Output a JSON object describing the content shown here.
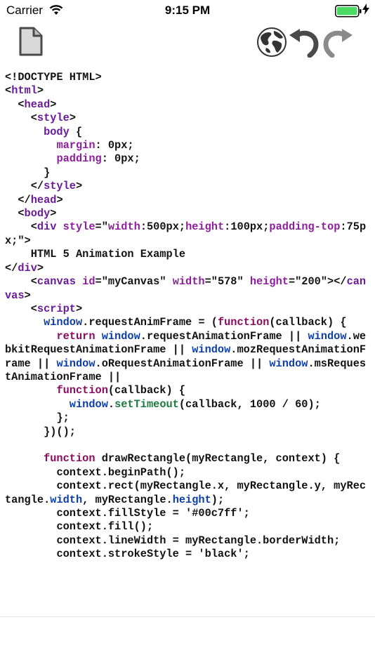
{
  "status_bar": {
    "carrier": "Carrier",
    "time": "9:15 PM"
  },
  "toolbar": {
    "icons": [
      "file-icon",
      "globe-icon",
      "undo-icon",
      "redo-icon"
    ]
  },
  "colors": {
    "default": "#111111",
    "tag": "#6a1b9a",
    "attr": "#8e1e9e",
    "keyword": "#8b0c5f",
    "ident": "#0d3ea8",
    "func": "#1b7a3d",
    "battery": "#4cd964"
  },
  "code": {
    "lines": [
      [
        [
          "default",
          "<!DOCTYPE HTML>"
        ]
      ],
      [
        [
          "default",
          "<"
        ],
        [
          "tag",
          "html"
        ],
        [
          "default",
          ">"
        ]
      ],
      [
        [
          "default",
          "  <"
        ],
        [
          "tag",
          "head"
        ],
        [
          "default",
          ">"
        ]
      ],
      [
        [
          "default",
          "    <"
        ],
        [
          "tag",
          "style"
        ],
        [
          "default",
          ">"
        ]
      ],
      [
        [
          "default",
          "      "
        ],
        [
          "tag",
          "body"
        ],
        [
          "default",
          " {"
        ]
      ],
      [
        [
          "default",
          "        "
        ],
        [
          "attr",
          "margin"
        ],
        [
          "default",
          ": 0px;"
        ]
      ],
      [
        [
          "default",
          "        "
        ],
        [
          "attr",
          "padding"
        ],
        [
          "default",
          ": 0px;"
        ]
      ],
      [
        [
          "default",
          "      }"
        ]
      ],
      [
        [
          "default",
          "    </"
        ],
        [
          "tag",
          "style"
        ],
        [
          "default",
          ">"
        ]
      ],
      [
        [
          "default",
          "  </"
        ],
        [
          "tag",
          "head"
        ],
        [
          "default",
          ">"
        ]
      ],
      [
        [
          "default",
          "  <"
        ],
        [
          "tag",
          "body"
        ],
        [
          "default",
          ">"
        ]
      ],
      [
        [
          "default",
          "    <"
        ],
        [
          "tag",
          "div"
        ],
        [
          "default",
          " "
        ],
        [
          "attr",
          "style"
        ],
        [
          "default",
          "=\""
        ],
        [
          "attr",
          "width"
        ],
        [
          "default",
          ":500px;"
        ],
        [
          "attr",
          "height"
        ],
        [
          "default",
          ":100px;"
        ],
        [
          "attr",
          "padding-top"
        ],
        [
          "default",
          ":75px;\">"
        ]
      ],
      [
        [
          "default",
          "    HTML 5 Animation Example"
        ]
      ],
      [
        [
          "default",
          "</"
        ],
        [
          "tag",
          "div"
        ],
        [
          "default",
          ">"
        ]
      ],
      [
        [
          "default",
          "    <"
        ],
        [
          "tag",
          "canvas"
        ],
        [
          "default",
          " "
        ],
        [
          "attr",
          "id"
        ],
        [
          "default",
          "=\"myCanvas\" "
        ],
        [
          "attr",
          "width"
        ],
        [
          "default",
          "=\"578\" "
        ],
        [
          "attr",
          "height"
        ],
        [
          "default",
          "=\"200\"></"
        ],
        [
          "tag",
          "canvas"
        ],
        [
          "default",
          ">"
        ]
      ],
      [
        [
          "default",
          "    <"
        ],
        [
          "tag",
          "script"
        ],
        [
          "default",
          ">"
        ]
      ],
      [
        [
          "default",
          "      "
        ],
        [
          "ident",
          "window"
        ],
        [
          "default",
          ".requestAnimFrame = ("
        ],
        [
          "keyword",
          "function"
        ],
        [
          "default",
          "(callback) {"
        ]
      ],
      [
        [
          "default",
          "        "
        ],
        [
          "keyword",
          "return"
        ],
        [
          "default",
          " "
        ],
        [
          "ident",
          "window"
        ],
        [
          "default",
          ".requestAnimationFrame || "
        ],
        [
          "ident",
          "window"
        ],
        [
          "default",
          ".webkitRequestAnimationFrame || "
        ],
        [
          "ident",
          "window"
        ],
        [
          "default",
          ".mozRequestAnimationFrame || "
        ],
        [
          "ident",
          "window"
        ],
        [
          "default",
          ".oRequestAnimationFrame || "
        ],
        [
          "ident",
          "window"
        ],
        [
          "default",
          ".msRequestAnimationFrame ||"
        ]
      ],
      [
        [
          "default",
          "        "
        ],
        [
          "keyword",
          "function"
        ],
        [
          "default",
          "(callback) {"
        ]
      ],
      [
        [
          "default",
          "          "
        ],
        [
          "ident",
          "window"
        ],
        [
          "default",
          "."
        ],
        [
          "func",
          "setTimeout"
        ],
        [
          "default",
          "(callback, 1000 / 60);"
        ]
      ],
      [
        [
          "default",
          "        };"
        ]
      ],
      [
        [
          "default",
          "      })();"
        ]
      ],
      [
        [
          "default",
          ""
        ]
      ],
      [
        [
          "default",
          "      "
        ],
        [
          "keyword",
          "function"
        ],
        [
          "default",
          " drawRectangle(myRectangle, context) {"
        ]
      ],
      [
        [
          "default",
          "        context.beginPath();"
        ]
      ],
      [
        [
          "default",
          "        context.rect(myRectangle.x, myRectangle.y, myRectangle."
        ],
        [
          "ident",
          "width"
        ],
        [
          "default",
          ", myRectangle."
        ],
        [
          "ident",
          "height"
        ],
        [
          "default",
          ");"
        ]
      ],
      [
        [
          "default",
          "        context.fillStyle = '#00c7ff';"
        ]
      ],
      [
        [
          "default",
          "        context.fill();"
        ]
      ],
      [
        [
          "default",
          "        context.lineWidth = myRectangle.borderWidth;"
        ]
      ],
      [
        [
          "default",
          "        context.strokeStyle = 'black';"
        ]
      ]
    ]
  }
}
